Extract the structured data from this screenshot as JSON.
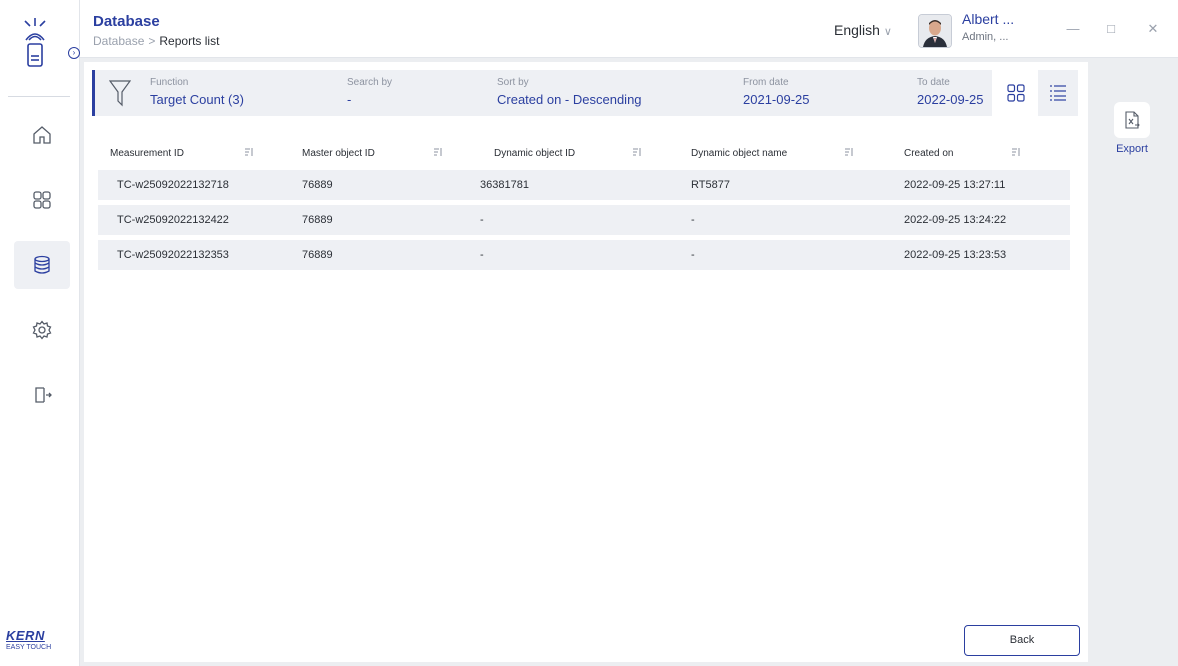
{
  "header": {
    "title": "Database",
    "breadcrumb_root": "Database",
    "breadcrumb_sep": ">",
    "breadcrumb_current": "Reports list",
    "language": "English",
    "user_name": "Albert ...",
    "user_role": "Admin, ..."
  },
  "sidebar": {
    "items": [
      {
        "name": "home",
        "icon": "home-icon",
        "active": false
      },
      {
        "name": "dashboard",
        "icon": "grid-icon",
        "active": false
      },
      {
        "name": "database",
        "icon": "database-icon",
        "active": true
      },
      {
        "name": "settings",
        "icon": "gear-icon",
        "active": false
      },
      {
        "name": "logout",
        "icon": "logout-icon",
        "active": false
      }
    ],
    "brand": "KERN",
    "brand_sub": "EASY TOUCH"
  },
  "filters": {
    "function_label": "Function",
    "function_value": "Target Count (3)",
    "search_label": "Search by",
    "search_value": "-",
    "sort_label": "Sort by",
    "sort_value": "Created on - Descending",
    "from_label": "From date",
    "from_value": "2021-09-25",
    "to_label": "To date",
    "to_value": "2022-09-25"
  },
  "table": {
    "columns": [
      "Measurement ID",
      "Master object ID",
      "Dynamic object ID",
      "Dynamic object name",
      "Created on"
    ],
    "rows": [
      [
        "TC-w25092022132718",
        "76889",
        "36381781",
        "RT5877",
        "2022-09-25 13:27:11"
      ],
      [
        "TC-w25092022132422",
        "76889",
        "-",
        "-",
        "2022-09-25 13:24:22"
      ],
      [
        "TC-w25092022132353",
        "76889",
        "-",
        "-",
        "2022-09-25 13:23:53"
      ]
    ]
  },
  "actions": {
    "back": "Back",
    "export": "Export"
  },
  "colors": {
    "accent": "#2b3fa0",
    "row_bg": "#eef0f4"
  }
}
